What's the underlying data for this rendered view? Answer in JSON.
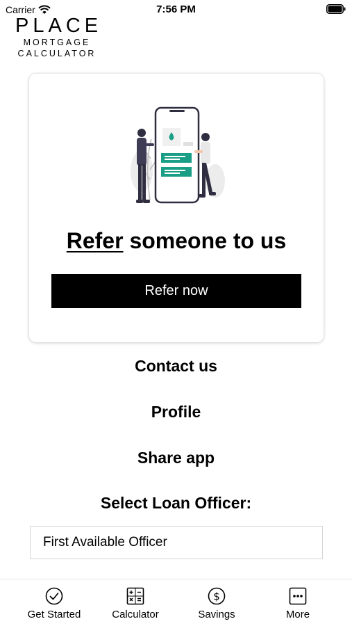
{
  "status_bar": {
    "carrier": "Carrier",
    "time": "7:56 PM"
  },
  "logo": {
    "main": "PLACE",
    "line1": "MORTGAGE",
    "line2": "CALCULATOR"
  },
  "refer_card": {
    "heading_link": "Refer",
    "heading_rest": " someone to us",
    "button_label": "Refer now",
    "accent_color": "#1a9e86"
  },
  "menu": {
    "contact": "Contact us",
    "profile": "Profile",
    "share": "Share app"
  },
  "loan_officer": {
    "label": "Select Loan Officer:",
    "selected": "First Available Officer"
  },
  "tabs": [
    {
      "label": "Get Started",
      "icon": "check-circle-icon"
    },
    {
      "label": "Calculator",
      "icon": "calculator-icon"
    },
    {
      "label": "Savings",
      "icon": "dollar-circle-icon"
    },
    {
      "label": "More",
      "icon": "more-dots-icon"
    }
  ]
}
